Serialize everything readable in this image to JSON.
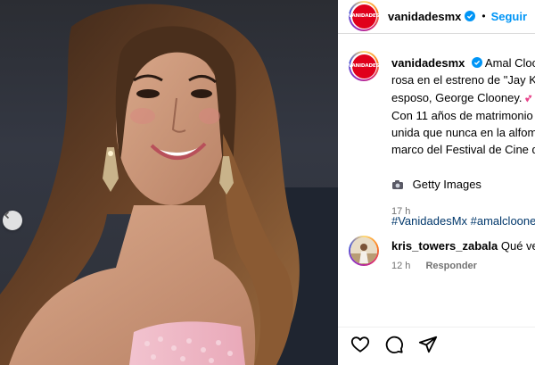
{
  "post": {
    "username": "vanidadesmx",
    "follow_label": "Seguir",
    "separator": "•",
    "avatar_logo_text": "VANIDADES"
  },
  "caption": {
    "username": "vanidadesmx",
    "line1": "Amal Clooney",
    "line2": "rosa en el estreno de \"Jay Ke",
    "line3": "esposo, George Clooney.",
    "line4": "Con 11 años de matrimonio",
    "line5": "unida que nunca en la alfom",
    "line6": "marco del Festival de Cine de",
    "credit": "Getty Images",
    "hashtags": "#VanidadesMx #amalclooney",
    "time": "17 h"
  },
  "comment": {
    "username": "kris_towers_zabala",
    "text": "Qué vesti",
    "time": "12 h",
    "reply_label": "Responder"
  },
  "icons": {
    "like": "heart-icon",
    "comment": "comment-icon",
    "share": "share-icon",
    "verified": "verified-badge-icon",
    "carousel_prev": "chevron-left-icon"
  },
  "colors": {
    "accent_blue": "#0095f6",
    "verified_blue": "#0095f6",
    "brand_red": "#e0001b",
    "meta_gray": "#737373",
    "hashtag_blue": "#00376b"
  }
}
